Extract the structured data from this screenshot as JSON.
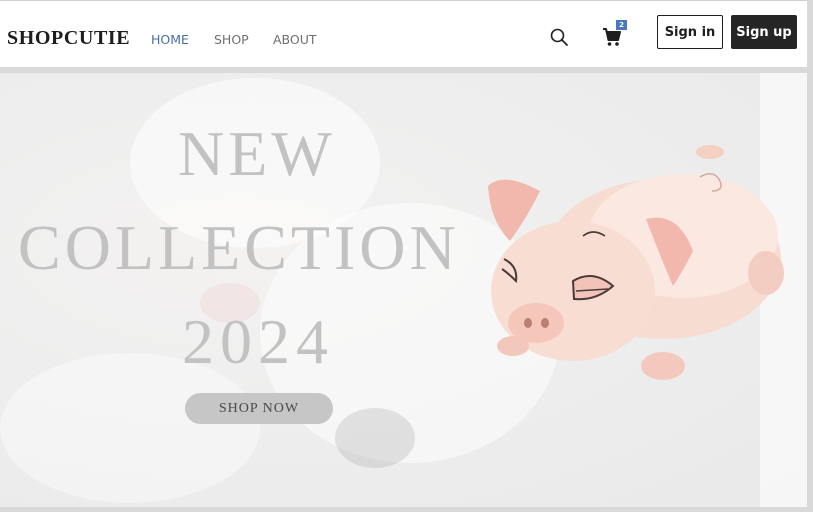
{
  "header": {
    "logo": "SHOPCUTIE",
    "nav": [
      {
        "label": "HOME",
        "active": true
      },
      {
        "label": "SHOP",
        "active": false
      },
      {
        "label": "ABOUT",
        "active": false
      }
    ],
    "cart_count": "2",
    "signin_label": "Sign in",
    "signup_label": "Sign up",
    "icons": {
      "search": "search-icon",
      "cart": "cart-icon"
    }
  },
  "hero": {
    "title_lines": [
      "NEW",
      "COLLECTION",
      "2024"
    ],
    "cta_label": "SHOP NOW"
  },
  "colors": {
    "active_nav": "#4a6fa5",
    "badge": "#4a78c0",
    "signup_bg": "#252525",
    "hero_text": "#c2c2c2",
    "cta_bg": "#c6c6c6"
  }
}
